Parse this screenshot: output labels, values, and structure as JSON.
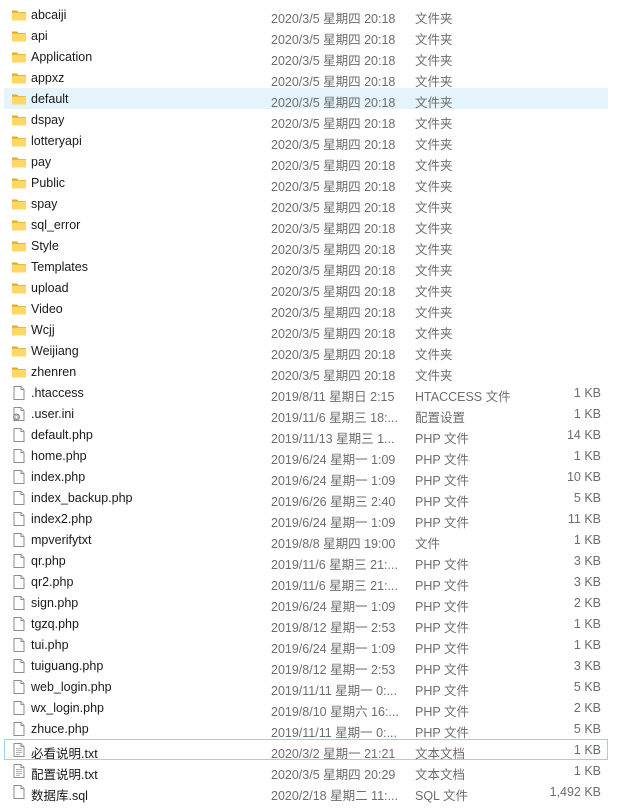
{
  "rows": [
    {
      "name": "abcaiji",
      "date": "2020/3/5 星期四 20:18",
      "type": "文件夹",
      "size": "",
      "icon": "folder-icon"
    },
    {
      "name": "api",
      "date": "2020/3/5 星期四 20:18",
      "type": "文件夹",
      "size": "",
      "icon": "folder-icon"
    },
    {
      "name": "Application",
      "date": "2020/3/5 星期四 20:18",
      "type": "文件夹",
      "size": "",
      "icon": "folder-icon"
    },
    {
      "name": "appxz",
      "date": "2020/3/5 星期四 20:18",
      "type": "文件夹",
      "size": "",
      "icon": "folder-icon"
    },
    {
      "name": "default",
      "date": "2020/3/5 星期四 20:18",
      "type": "文件夹",
      "size": "",
      "icon": "folder-icon",
      "state": "hover"
    },
    {
      "name": "dspay",
      "date": "2020/3/5 星期四 20:18",
      "type": "文件夹",
      "size": "",
      "icon": "folder-icon"
    },
    {
      "name": "lotteryapi",
      "date": "2020/3/5 星期四 20:18",
      "type": "文件夹",
      "size": "",
      "icon": "folder-icon"
    },
    {
      "name": "pay",
      "date": "2020/3/5 星期四 20:18",
      "type": "文件夹",
      "size": "",
      "icon": "folder-icon"
    },
    {
      "name": "Public",
      "date": "2020/3/5 星期四 20:18",
      "type": "文件夹",
      "size": "",
      "icon": "folder-icon"
    },
    {
      "name": "spay",
      "date": "2020/3/5 星期四 20:18",
      "type": "文件夹",
      "size": "",
      "icon": "folder-icon"
    },
    {
      "name": "sql_error",
      "date": "2020/3/5 星期四 20:18",
      "type": "文件夹",
      "size": "",
      "icon": "folder-icon"
    },
    {
      "name": "Style",
      "date": "2020/3/5 星期四 20:18",
      "type": "文件夹",
      "size": "",
      "icon": "folder-icon"
    },
    {
      "name": "Templates",
      "date": "2020/3/5 星期四 20:18",
      "type": "文件夹",
      "size": "",
      "icon": "folder-icon"
    },
    {
      "name": "upload",
      "date": "2020/3/5 星期四 20:18",
      "type": "文件夹",
      "size": "",
      "icon": "folder-icon"
    },
    {
      "name": "Video",
      "date": "2020/3/5 星期四 20:18",
      "type": "文件夹",
      "size": "",
      "icon": "folder-icon"
    },
    {
      "name": "Wcjj",
      "date": "2020/3/5 星期四 20:18",
      "type": "文件夹",
      "size": "",
      "icon": "folder-icon"
    },
    {
      "name": "Weijiang",
      "date": "2020/3/5 星期四 20:18",
      "type": "文件夹",
      "size": "",
      "icon": "folder-icon"
    },
    {
      "name": "zhenren",
      "date": "2020/3/5 星期四 20:18",
      "type": "文件夹",
      "size": "",
      "icon": "folder-icon"
    },
    {
      "name": ".htaccess",
      "date": "2019/8/11 星期日 2:15",
      "type": "HTACCESS 文件",
      "size": "1 KB",
      "icon": "file-icon"
    },
    {
      "name": ".user.ini",
      "date": "2019/11/6 星期三 18:...",
      "type": "配置设置",
      "size": "1 KB",
      "icon": "settings-file-icon"
    },
    {
      "name": "default.php",
      "date": "2019/11/13 星期三 1...",
      "type": "PHP 文件",
      "size": "14 KB",
      "icon": "file-icon"
    },
    {
      "name": "home.php",
      "date": "2019/6/24 星期一 1:09",
      "type": "PHP 文件",
      "size": "1 KB",
      "icon": "file-icon"
    },
    {
      "name": "index.php",
      "date": "2019/6/24 星期一 1:09",
      "type": "PHP 文件",
      "size": "10 KB",
      "icon": "file-icon"
    },
    {
      "name": "index_backup.php",
      "date": "2019/6/26 星期三 2:40",
      "type": "PHP 文件",
      "size": "5 KB",
      "icon": "file-icon"
    },
    {
      "name": "index2.php",
      "date": "2019/6/24 星期一 1:09",
      "type": "PHP 文件",
      "size": "11 KB",
      "icon": "file-icon"
    },
    {
      "name": "mpverifytxt",
      "date": "2019/8/8 星期四 19:00",
      "type": "文件",
      "size": "1 KB",
      "icon": "file-icon"
    },
    {
      "name": "qr.php",
      "date": "2019/11/6 星期三 21:...",
      "type": "PHP 文件",
      "size": "3 KB",
      "icon": "file-icon"
    },
    {
      "name": "qr2.php",
      "date": "2019/11/6 星期三 21:...",
      "type": "PHP 文件",
      "size": "3 KB",
      "icon": "file-icon"
    },
    {
      "name": "sign.php",
      "date": "2019/6/24 星期一 1:09",
      "type": "PHP 文件",
      "size": "2 KB",
      "icon": "file-icon"
    },
    {
      "name": "tgzq.php",
      "date": "2019/8/12 星期一 2:53",
      "type": "PHP 文件",
      "size": "1 KB",
      "icon": "file-icon"
    },
    {
      "name": "tui.php",
      "date": "2019/6/24 星期一 1:09",
      "type": "PHP 文件",
      "size": "1 KB",
      "icon": "file-icon"
    },
    {
      "name": "tuiguang.php",
      "date": "2019/8/12 星期一 2:53",
      "type": "PHP 文件",
      "size": "3 KB",
      "icon": "file-icon"
    },
    {
      "name": "web_login.php",
      "date": "2019/11/11 星期一 0:...",
      "type": "PHP 文件",
      "size": "5 KB",
      "icon": "file-icon"
    },
    {
      "name": "wx_login.php",
      "date": "2019/8/10 星期六 16:...",
      "type": "PHP 文件",
      "size": "2 KB",
      "icon": "file-icon"
    },
    {
      "name": "zhuce.php",
      "date": "2019/11/11 星期一 0:...",
      "type": "PHP 文件",
      "size": "5 KB",
      "icon": "file-icon"
    },
    {
      "name": "必看说明.txt",
      "date": "2020/3/2 星期一 21:21",
      "type": "文本文档",
      "size": "1 KB",
      "icon": "text-file-icon",
      "state": "focused"
    },
    {
      "name": "配置说明.txt",
      "date": "2020/3/5 星期四 20:29",
      "type": "文本文档",
      "size": "1 KB",
      "icon": "text-file-icon"
    },
    {
      "name": "数据库.sql",
      "date": "2020/2/18 星期二 11:...",
      "type": "SQL 文件",
      "size": "1,492 KB",
      "icon": "file-icon"
    }
  ]
}
